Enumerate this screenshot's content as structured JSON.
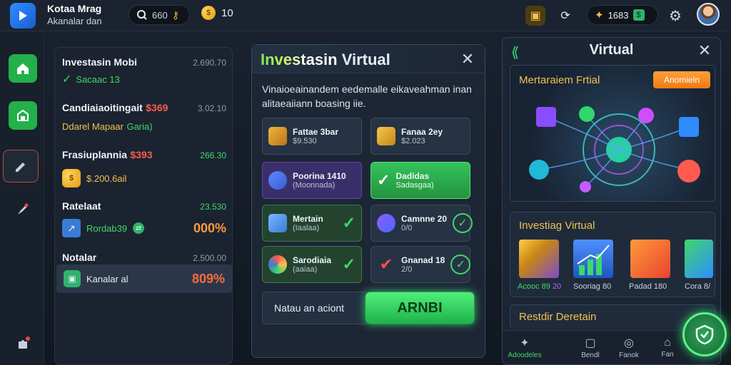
{
  "header": {
    "title": "Kotaa Mrag",
    "subtitle": "Akanalar dan",
    "search_value": "660",
    "coins": "10",
    "balance": "1683"
  },
  "left_list": {
    "items": [
      {
        "title": "Investasin Mobi",
        "num": "2.690.70",
        "sub": "Sacaac 13"
      },
      {
        "title": "Candiaiaoitingait",
        "badge": "$369",
        "num": "3.02.10",
        "sub": "Ddarel Mapaar",
        "sub2": "Garia)"
      },
      {
        "title": "Frasiuplannia",
        "badge": "$393",
        "num": "266.30",
        "sub": "$.200.6ail"
      },
      {
        "title": "Ratelaat",
        "num": "23.530",
        "sub": "Rordab39",
        "sub2": "000%"
      },
      {
        "title": "Notalar",
        "num": "2.500.00",
        "sub": "Kanalar al",
        "sub2": "809%"
      }
    ]
  },
  "modal": {
    "title_grad": "Investasin",
    "title_rest": " Virtual",
    "close": "✕",
    "description": "Vinaioeainandem eedemalle eikaveahman inan alitaeaiiann boasing iie.",
    "cards": [
      {
        "t1": "Fattae 3bar",
        "t2": "$9.530"
      },
      {
        "t1": "Fanaa 2ey",
        "t2": "$2.023"
      },
      {
        "t1": "Poorina 1410",
        "t2": "(Moonnada)"
      },
      {
        "t1": "Dadidas",
        "t2": "Sadasgaa)"
      },
      {
        "t1": "Mertain",
        "t2": "(Iaalaa)"
      },
      {
        "t1": "Camnne 20",
        "t2": "0/0"
      },
      {
        "t1": "Sarodiaia",
        "t2": "(aaiaa)"
      },
      {
        "t1": "Gnanad 18",
        "t2": "2/0"
      }
    ],
    "footer_label": "Natau an aciont",
    "primary_button": "ARNBI"
  },
  "right_panel": {
    "title": "Virtual",
    "hero_title": "Mertaraiem Frtial",
    "hero_button": "Anomieln",
    "invest_title": "Investiag Virtual",
    "thumbs": [
      {
        "label": "Acooc 89",
        "val": "20"
      },
      {
        "label": "Sooriag 80",
        "val": ""
      },
      {
        "label": "Padad 180",
        "val": ""
      },
      {
        "label": "Cora 8/",
        "val": ""
      }
    ],
    "deals_title": "Restdir Deretain",
    "nav": [
      "Adoodeles",
      "Bendl",
      "Fanok",
      "Fan"
    ]
  }
}
